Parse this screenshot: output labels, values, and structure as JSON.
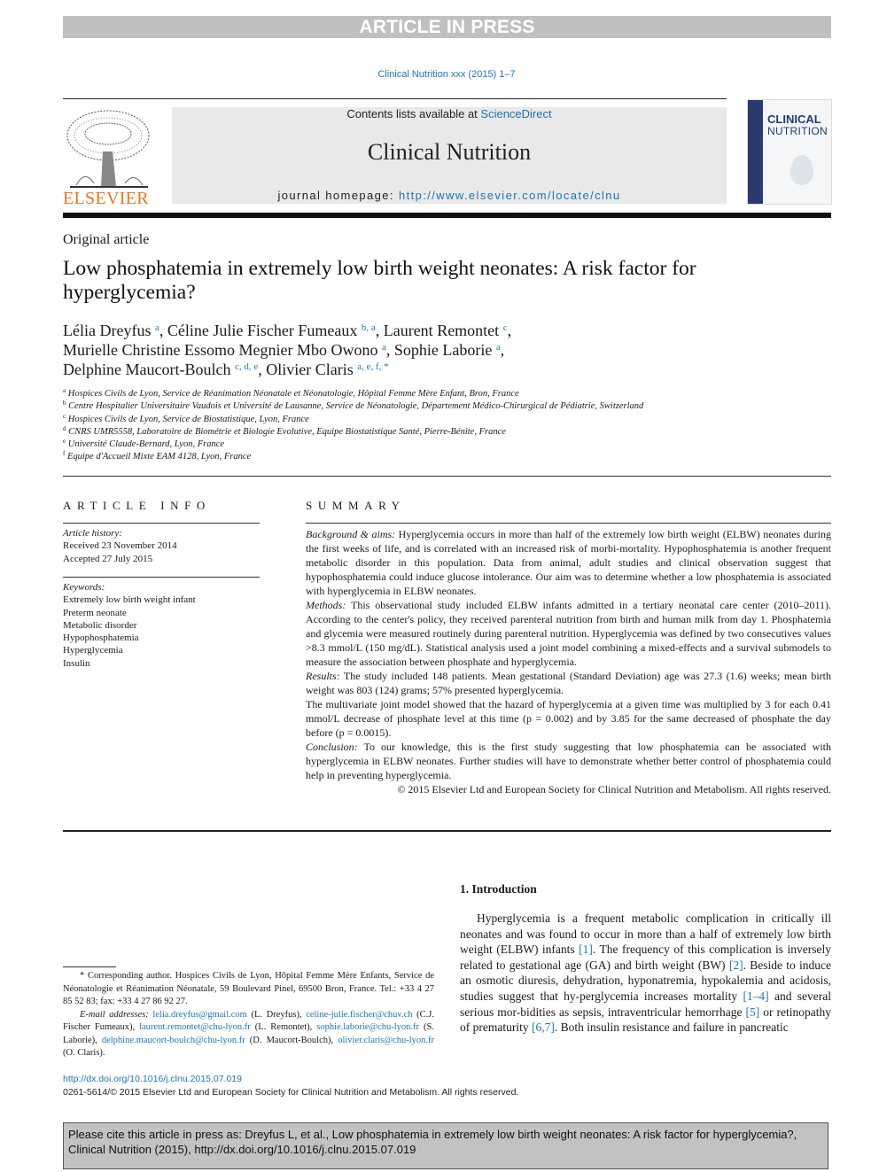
{
  "banner": "ARTICLE IN PRESS",
  "journal_ref": "Clinical Nutrition xxx (2015) 1–7",
  "header": {
    "publisher_logo_text": "ELSEVIER",
    "contents_prefix": "Contents lists available at ",
    "contents_link": "ScienceDirect",
    "journal_title": "Clinical Nutrition",
    "homepage_prefix": "journal homepage: ",
    "homepage_link": "http://www.elsevier.com/locate/clnu",
    "cover_line1": "CLINICAL",
    "cover_line2": "NUTRITION"
  },
  "article": {
    "type": "Original article",
    "title": "Low phosphatemia in extremely low birth weight neonates: A risk factor for hyperglycemia?",
    "authors": [
      {
        "name": "Lélia Dreyfus",
        "sup": "a",
        "sep": ", "
      },
      {
        "name": "Céline Julie Fischer Fumeaux",
        "sup": "b, a",
        "sep": ", "
      },
      {
        "name": "Laurent Remontet",
        "sup": "c",
        "sep": ","
      },
      {
        "name": "Murielle Christine Essomo Megnier Mbo Owono",
        "sup": "a",
        "sep": ", "
      },
      {
        "name": "Sophie Laborie",
        "sup": "a",
        "sep": ","
      },
      {
        "name": "Delphine Maucort-Boulch",
        "sup": "c, d, e",
        "sep": ", "
      },
      {
        "name": "Olivier Claris",
        "sup": "a, e, f, *",
        "sep": ""
      }
    ],
    "affiliations": [
      {
        "key": "a",
        "text": "Hospices Civils de Lyon, Service de Réanimation Néonatale et Néonatologie, Hôpital Femme Mère Enfant, Bron, France"
      },
      {
        "key": "b",
        "text": "Centre Hospitalier Universitaire Vaudois et Université de Lausanne, Service de Néonatologie, Département Médico-Chirurgical de Pédiatrie, Switzerland"
      },
      {
        "key": "c",
        "text": "Hospices Civils de Lyon, Service de Biostatistique, Lyon, France"
      },
      {
        "key": "d",
        "text": "CNRS UMR5558, Laboratoire de Biométrie et Biologie Evolutive, Equipe Biostatistique Santé, Pierre-Bénite, France"
      },
      {
        "key": "e",
        "text": "Université Claude-Bernard, Lyon, France"
      },
      {
        "key": "f",
        "text": "Equipe d'Accueil Mixte EAM 4128, Lyon, France"
      }
    ]
  },
  "article_info": {
    "heading": "ARTICLE INFO",
    "history_label": "Article history:",
    "received": "Received 23 November 2014",
    "accepted": "Accepted 27 July 2015",
    "keywords_label": "Keywords:",
    "keywords": [
      "Extremely low birth weight infant",
      "Preterm neonate",
      "Metabolic disorder",
      "Hypophosphatemia",
      "Hyperglycemia",
      "Insulin"
    ]
  },
  "summary": {
    "heading": "SUMMARY",
    "sections": [
      {
        "label": "Background & aims:",
        "text": " Hyperglycemia occurs in more than half of the extremely low birth weight (ELBW) neonates during the first weeks of life, and is correlated with an increased risk of morbi-mortality. Hypophosphatemia is another frequent metabolic disorder in this population. Data from animal, adult studies and clinical observation suggest that hypophosphatemia could induce glucose intolerance. Our aim was to determine whether a low phosphatemia is associated with hyperglycemia in ELBW neonates."
      },
      {
        "label": "Methods:",
        "text": " This observational study included ELBW infants admitted in a tertiary neonatal care center (2010–2011). According to the center's policy, they received parenteral nutrition from birth and human milk from day 1. Phosphatemia and glycemia were measured routinely during parenteral nutrition. Hyperglycemia was defined by two consecutives values >8.3 mmol/L (150 mg/dL). Statistical analysis used a joint model combining a mixed-effects and a survival submodels to measure the association between phosphate and hyperglycemia."
      },
      {
        "label": "Results:",
        "text": " The study included 148 patients. Mean gestational (Standard Deviation) age was 27.3 (1.6) weeks; mean birth weight was 803 (124) grams; 57% presented hyperglycemia."
      },
      {
        "label": "",
        "text": "The multivariate joint model showed that the hazard of hyperglycemia at a given time was multiplied by 3 for each 0.41 mmol/L decrease of phosphate level at this time (p = 0.002) and by 3.85 for the same decreased of phosphate the day before (p = 0.0015)."
      },
      {
        "label": "Conclusion:",
        "text": " To our knowledge, this is the first study suggesting that low phosphatemia can be associated with hyperglycemia in ELBW neonates. Further studies will have to demonstrate whether better control of phosphatemia could help in preventing hyperglycemia."
      }
    ],
    "copyright": "© 2015 Elsevier Ltd and European Society for Clinical Nutrition and Metabolism. All rights reserved."
  },
  "introduction": {
    "heading": "1.  Introduction",
    "parts": [
      {
        "t": "Hyperglycemia is a frequent metabolic complication in critically ill neonates and was found to occur in more than a half of extremely low birth weight (ELBW) infants "
      },
      {
        "ref": "[1]"
      },
      {
        "t": ". The frequency of this complication is inversely related to gestational age (GA) and birth weight (BW) "
      },
      {
        "ref": "[2]"
      },
      {
        "t": ". Beside to induce an osmotic diuresis, dehydration, hyponatremia, hypokalemia and acidosis, studies suggest that hy-perglycemia increases mortality "
      },
      {
        "ref": "[1–4]"
      },
      {
        "t": " and several serious mor-bidities as sepsis, intraventricular hemorrhage "
      },
      {
        "ref": "[5]"
      },
      {
        "t": " or retinopathy of prematurity "
      },
      {
        "ref": "[6,7]"
      },
      {
        "t": ". Both insulin resistance and failure in pancreatic"
      }
    ]
  },
  "footnote": {
    "corresponding": "* Corresponding author. Hospices Civils de Lyon, Hôpital Femme Mère Enfants, Service de Néonatologie et Réanimation Néonatale, 59 Boulevard Pinel, 69500 Bron, France. Tel.: +33 4 27 85 52 83; fax: +33 4 27 86 92 27.",
    "email_label": "E-mail addresses:",
    "emails": [
      {
        "email": "lelia.dreyfus@gmail.com",
        "who": " (L. Dreyfus), "
      },
      {
        "email": "celine-julie.fischer@chuv.ch",
        "who": " (C.J. Fischer Fumeaux), "
      },
      {
        "email": "laurent.remontet@chu-lyon.fr",
        "who": " (L. Remontet), "
      },
      {
        "email": "sophie.laborie@chu-lyon.fr",
        "who": " (S. Laborie), "
      },
      {
        "email": "delphine.maucort-boulch@chu-lyon.fr",
        "who": " (D. Maucort-Boulch), "
      },
      {
        "email": "olivier.claris@chu-lyon.fr",
        "who": " (O. Claris)."
      }
    ]
  },
  "doi_link": "http://dx.doi.org/10.1016/j.clnu.2015.07.019",
  "issn_line": "0261-5614/© 2015 Elsevier Ltd and European Society for Clinical Nutrition and Metabolism. All rights reserved.",
  "cite_box": "Please cite this article in press as: Dreyfus L, et al., Low phosphatemia in extremely low birth weight neonates: A risk factor for hyperglycemia?, Clinical Nutrition (2015), http://dx.doi.org/10.1016/j.clnu.2015.07.019"
}
